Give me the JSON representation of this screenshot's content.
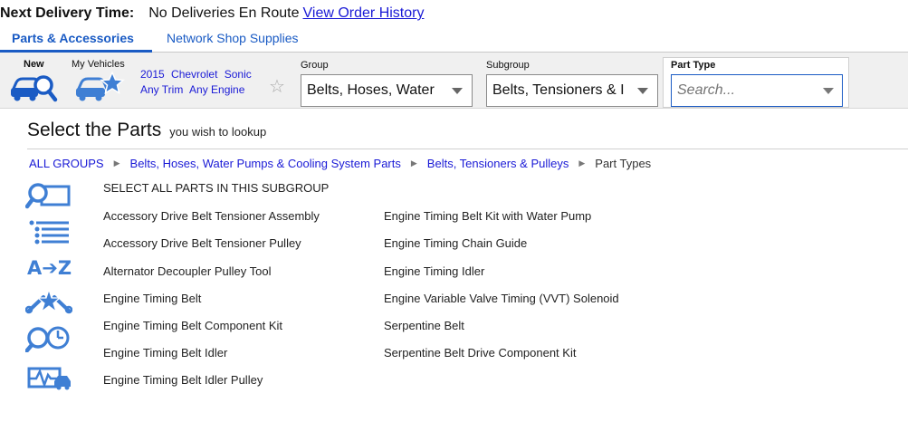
{
  "delivery": {
    "label": "Next Delivery Time:",
    "value": "No Deliveries En Route",
    "link": "View Order History"
  },
  "tabs": [
    {
      "label": "Parts & Accessories",
      "active": true
    },
    {
      "label": "Network Shop Supplies",
      "active": false
    }
  ],
  "toolbar": {
    "new_label": "New",
    "my_vehicles_label": "My Vehicles",
    "vehicle": {
      "year": "2015",
      "make": "Chevrolet",
      "model": "Sonic",
      "trim": "Any Trim",
      "engine": "Any Engine"
    },
    "group": {
      "label": "Group",
      "value": "Belts, Hoses, Water"
    },
    "subgroup": {
      "label": "Subgroup",
      "value": "Belts, Tensioners & I"
    },
    "part_type": {
      "label": "Part Type",
      "placeholder": "Search..."
    }
  },
  "heading": {
    "main": "Select the Parts",
    "sub": "you wish to lookup"
  },
  "breadcrumb": [
    "ALL GROUPS",
    "Belts, Hoses, Water Pumps & Cooling System Parts",
    "Belts, Tensioners & Pulleys",
    "Part Types"
  ],
  "select_all": "SELECT ALL PARTS IN THIS SUBGROUP",
  "parts_col1": [
    "Accessory Drive Belt Tensioner Assembly",
    "Accessory Drive Belt Tensioner Pulley",
    "Alternator Decoupler Pulley Tool",
    "Engine Timing Belt",
    "Engine Timing Belt Component Kit",
    "Engine Timing Belt Idler",
    "Engine Timing Belt Idler Pulley"
  ],
  "parts_col2": [
    "Engine Timing Belt Kit with Water Pump",
    "Engine Timing Chain Guide",
    "Engine Timing Idler",
    "Engine Variable Valve Timing (VVT) Solenoid",
    "Serpentine Belt",
    "Serpentine Belt Drive Component Kit"
  ],
  "colors": {
    "link": "#1a1ad6",
    "accent": "#1a5bc4",
    "icon": "#3f7fd4"
  }
}
